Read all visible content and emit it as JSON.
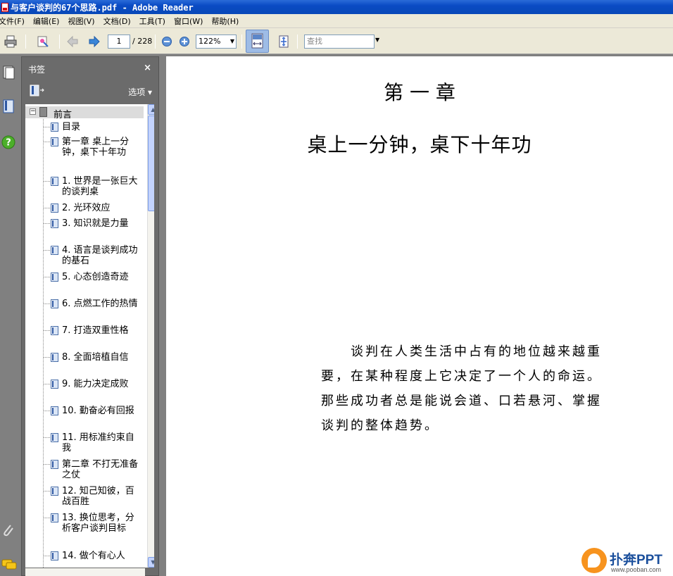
{
  "window": {
    "title": "与客户谈判的67个思路.pdf - Adobe Reader"
  },
  "menu": [
    "文件(F)",
    "编辑(E)",
    "视图(V)",
    "文档(D)",
    "工具(T)",
    "窗口(W)",
    "帮助(H)"
  ],
  "toolbar": {
    "page_current": "1",
    "page_total": "/ 228",
    "zoom": "122%",
    "find_placeholder": "查找"
  },
  "bookmarks": {
    "title": "书签",
    "close": "×",
    "options": "选项 ▾",
    "root": "前言",
    "items": [
      "目录",
      "第一章  桌上一分钟，桌下十年功",
      "1.  世界是一张巨大的谈判桌",
      "2.  光环效应",
      "3.  知识就是力量",
      "4.  语言是谈判成功的基石",
      "5.  心态创造奇迹",
      "6.  点燃工作的热情",
      "7.  打造双重性格",
      "8.  全面培植自信",
      "9.  能力决定成败",
      "10.  勤奋必有回报",
      "11.  用标准约束自我",
      "第二章  不打无准备之仗",
      "12.  知己知彼，百战百胜",
      "13.  换位思考，分析客户谈判目标",
      "14.  做个有心人"
    ]
  },
  "document": {
    "chapter": "第 一 章",
    "title": "桌上一分钟，桌下十年功",
    "paragraph": "　　谈判在人类生活中占有的地位越来越重要，在某种程度上它决定了一个人的命运。那些成功者总是能说会道、口若悬河、掌握谈判的整体趋势。"
  },
  "watermark": {
    "brand": "扑奔PPT",
    "url": "www.pooban.com"
  }
}
